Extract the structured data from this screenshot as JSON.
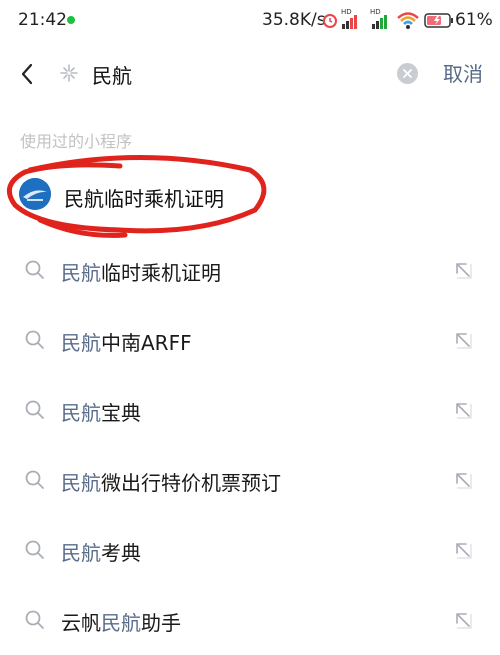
{
  "status_bar": {
    "time": "21:42",
    "net_speed": "35.8K/s",
    "battery": "61%",
    "signal_label_1": "HD",
    "signal_label_2": "HD"
  },
  "search": {
    "query": "民航",
    "cancel_label": "取消"
  },
  "used_section": {
    "title": "使用过的小程序",
    "item_name": "民航临时乘机证明"
  },
  "suggestions": [
    {
      "pre": "",
      "hl": "民航",
      "post": "临时乘机证明"
    },
    {
      "pre": "",
      "hl": "民航",
      "post": "中南ARFF"
    },
    {
      "pre": "",
      "hl": "民航",
      "post": "宝典"
    },
    {
      "pre": "",
      "hl": "民航",
      "post": "微出行特价机票预订"
    },
    {
      "pre": "",
      "hl": "民航",
      "post": "考典"
    },
    {
      "pre": "云帆",
      "hl": "民航",
      "post": "助手"
    }
  ],
  "colors": {
    "accent": "#566a86",
    "annotation": "#e0231c",
    "online_dot": "#1fbf3f"
  }
}
